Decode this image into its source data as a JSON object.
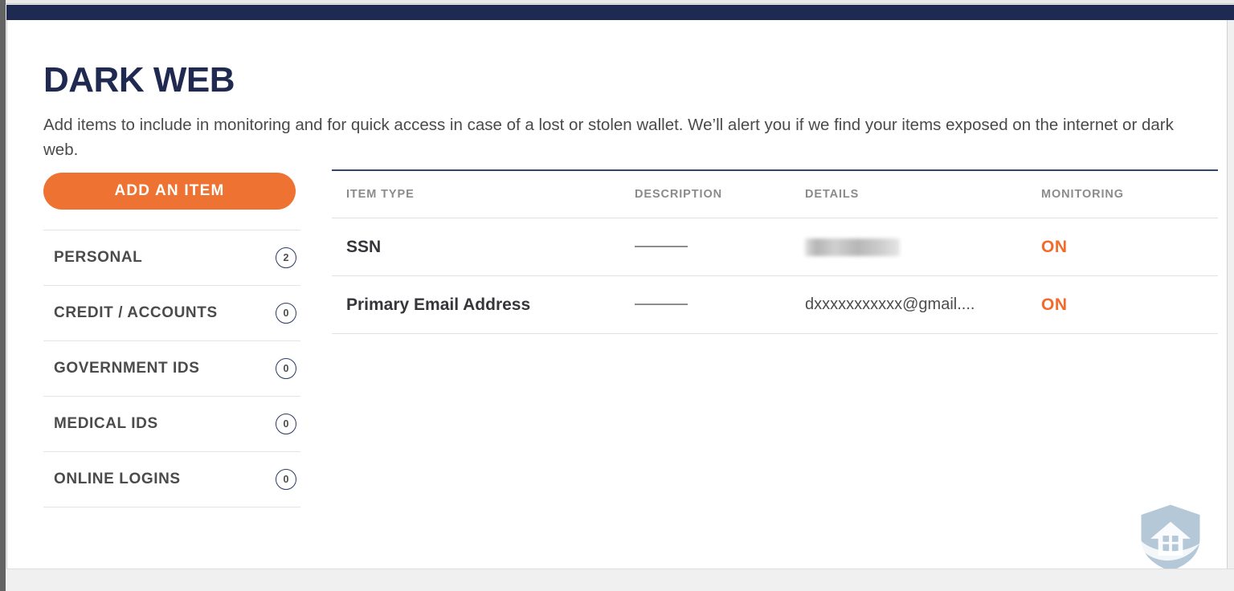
{
  "app": {
    "title": "DARK WEB",
    "description": "Add items to include in monitoring and for quick access in case of a lost or stolen wallet. We’ll alert you if we find your items exposed on the internet or dark web."
  },
  "colors": {
    "navy": "#1f2a52",
    "title_navy": "#20294f",
    "accent_orange": "#ee7231",
    "status_on_orange": "#f26b2b",
    "table_rule_navy": "#31456f",
    "watermark_blue": "#adc4d4"
  },
  "sidebar": {
    "add_button_label": "ADD AN ITEM",
    "items": [
      {
        "label": "PERSONAL",
        "count": "2"
      },
      {
        "label": "CREDIT / ACCOUNTS",
        "count": "0"
      },
      {
        "label": "GOVERNMENT IDS",
        "count": "0"
      },
      {
        "label": "MEDICAL IDS",
        "count": "0"
      },
      {
        "label": "ONLINE LOGINS",
        "count": "0"
      }
    ]
  },
  "table": {
    "columns": {
      "item_type": "ITEM TYPE",
      "description": "DESCRIPTION",
      "details": "DETAILS",
      "monitoring": "MONITORING"
    },
    "rows": [
      {
        "item_type": "SSN",
        "description": "———",
        "details": "",
        "details_redacted": true,
        "monitoring": "ON"
      },
      {
        "item_type": "Primary Email Address",
        "description": "———",
        "details": "dxxxxxxxxxxx@gmail....",
        "details_redacted": false,
        "monitoring": "ON"
      }
    ]
  },
  "watermark": {
    "icon": "house-shield-icon"
  }
}
